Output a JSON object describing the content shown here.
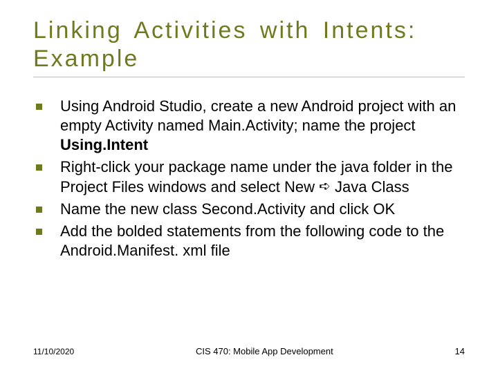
{
  "title": "Linking Activities with Intents: Example",
  "bullets": [
    {
      "pre": "Using Android Studio, create a new Android project with an empty Activity named Main.Activity; name the project ",
      "bold": "Using.Intent",
      "post": ""
    },
    {
      "pre": "Right-click your package name under the java folder in the Project Files windows and select New ",
      "arrow": "➪",
      "post": " Java Class"
    },
    {
      "pre": "Name the new class Second.Activity and click OK"
    },
    {
      "pre": "Add the bolded statements from the following code to the Android.Manifest. xml file"
    }
  ],
  "footer": {
    "date": "11/10/2020",
    "course": "CIS 470: Mobile App Development",
    "page": "14"
  }
}
